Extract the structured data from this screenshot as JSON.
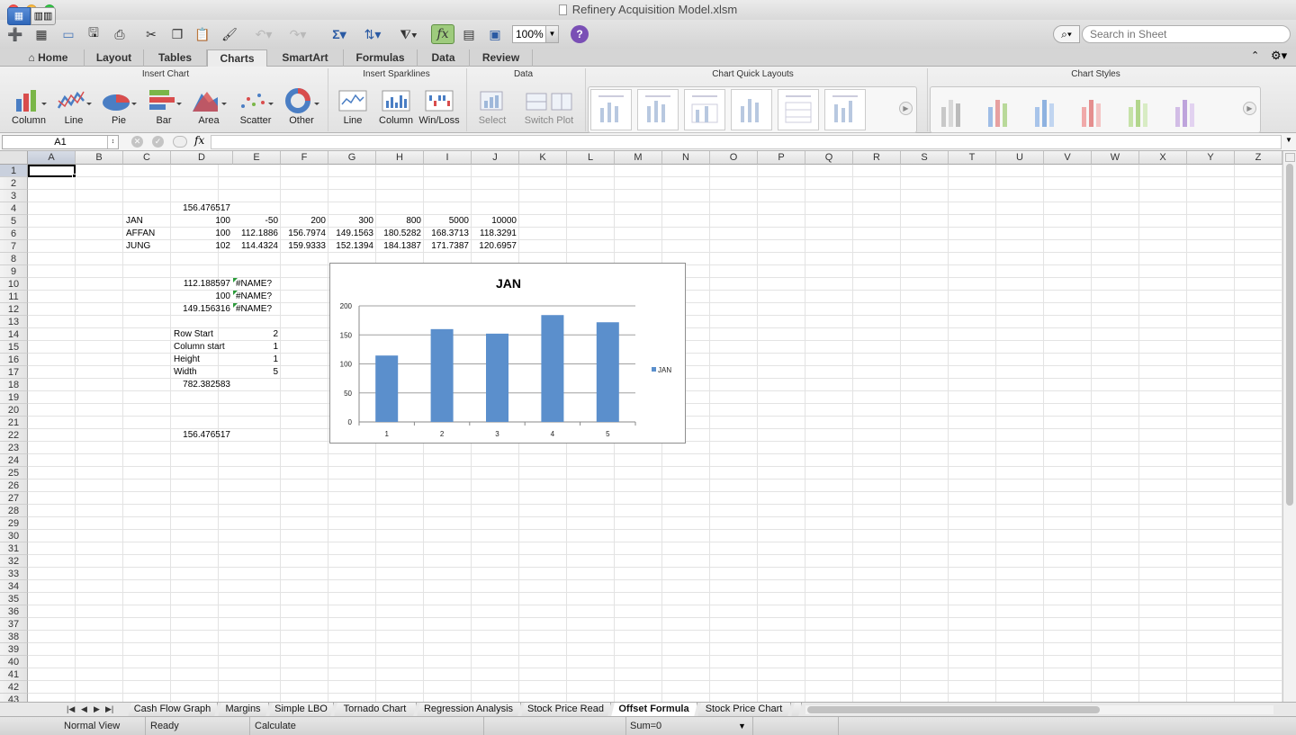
{
  "window": {
    "title": "Refinery Acquisition Model.xlsm"
  },
  "toolbar": {
    "zoom": "100%",
    "search_placeholder": "Search in Sheet"
  },
  "ribbon_tabs": [
    "Home",
    "Layout",
    "Tables",
    "Charts",
    "SmartArt",
    "Formulas",
    "Data",
    "Review"
  ],
  "ribbon_active_tab": "Charts",
  "ribbon": {
    "insert_chart": {
      "title": "Insert Chart",
      "buttons": [
        "Column",
        "Line",
        "Pie",
        "Bar",
        "Area",
        "Scatter",
        "Other"
      ]
    },
    "insert_sparklines": {
      "title": "Insert Sparklines",
      "buttons": [
        "Line",
        "Column",
        "Win/Loss"
      ]
    },
    "data": {
      "title": "Data",
      "buttons": [
        "Select",
        "Switch Plot"
      ]
    },
    "quick_layouts": {
      "title": "Chart Quick Layouts"
    },
    "chart_styles": {
      "title": "Chart Styles"
    }
  },
  "formula_bar": {
    "name_box": "A1",
    "fx_label": "fx",
    "formula": ""
  },
  "columns": [
    "A",
    "B",
    "C",
    "D",
    "E",
    "F",
    "G",
    "H",
    "I",
    "J",
    "K",
    "L",
    "M",
    "N",
    "O",
    "P",
    "Q",
    "R",
    "S",
    "T",
    "U",
    "V",
    "W",
    "X",
    "Y",
    "Z"
  ],
  "rows": [
    "1",
    "2",
    "3",
    "4",
    "5",
    "6",
    "7",
    "8",
    "9",
    "10",
    "11",
    "12",
    "13",
    "14",
    "15",
    "16",
    "17",
    "18",
    "19",
    "20",
    "21",
    "22",
    "23",
    "24",
    "25",
    "26",
    "27",
    "28",
    "29",
    "30",
    "31",
    "32",
    "33",
    "34",
    "35",
    "36",
    "37",
    "38",
    "39",
    "40",
    "41",
    "42",
    "43"
  ],
  "cells": [
    {
      "ref": "D4",
      "value": "156.476517",
      "align": "r"
    },
    {
      "ref": "C5",
      "value": "JAN",
      "align": "l"
    },
    {
      "ref": "D5",
      "value": "100",
      "align": "r"
    },
    {
      "ref": "E5",
      "value": "-50",
      "align": "r"
    },
    {
      "ref": "F5",
      "value": "200",
      "align": "r"
    },
    {
      "ref": "G5",
      "value": "300",
      "align": "r"
    },
    {
      "ref": "H5",
      "value": "800",
      "align": "r"
    },
    {
      "ref": "I5",
      "value": "5000",
      "align": "r"
    },
    {
      "ref": "J5",
      "value": "10000",
      "align": "r"
    },
    {
      "ref": "C6",
      "value": "AFFAN",
      "align": "l"
    },
    {
      "ref": "D6",
      "value": "100",
      "align": "r"
    },
    {
      "ref": "E6",
      "value": "112.1886",
      "align": "r"
    },
    {
      "ref": "F6",
      "value": "156.7974",
      "align": "r"
    },
    {
      "ref": "G6",
      "value": "149.1563",
      "align": "r"
    },
    {
      "ref": "H6",
      "value": "180.5282",
      "align": "r"
    },
    {
      "ref": "I6",
      "value": "168.3713",
      "align": "r"
    },
    {
      "ref": "J6",
      "value": "118.3291",
      "align": "r"
    },
    {
      "ref": "C7",
      "value": "JUNG",
      "align": "l"
    },
    {
      "ref": "D7",
      "value": "102",
      "align": "r"
    },
    {
      "ref": "E7",
      "value": "114.4324",
      "align": "r"
    },
    {
      "ref": "F7",
      "value": "159.9333",
      "align": "r"
    },
    {
      "ref": "G7",
      "value": "152.1394",
      "align": "r"
    },
    {
      "ref": "H7",
      "value": "184.1387",
      "align": "r"
    },
    {
      "ref": "I7",
      "value": "171.7387",
      "align": "r"
    },
    {
      "ref": "J7",
      "value": "120.6957",
      "align": "r"
    },
    {
      "ref": "D10",
      "value": "112.188597",
      "align": "r"
    },
    {
      "ref": "E10",
      "value": "#NAME?",
      "align": "l",
      "error": true
    },
    {
      "ref": "D11",
      "value": "100",
      "align": "r"
    },
    {
      "ref": "E11",
      "value": "#NAME?",
      "align": "l",
      "error": true
    },
    {
      "ref": "D12",
      "value": "149.156316",
      "align": "r"
    },
    {
      "ref": "E12",
      "value": "#NAME?",
      "align": "l",
      "error": true
    },
    {
      "ref": "D14",
      "value": "Row Start",
      "align": "l"
    },
    {
      "ref": "E14",
      "value": "2",
      "align": "r"
    },
    {
      "ref": "D15",
      "value": "Column start",
      "align": "l"
    },
    {
      "ref": "E15",
      "value": "1",
      "align": "r"
    },
    {
      "ref": "D16",
      "value": "Height",
      "align": "l"
    },
    {
      "ref": "E16",
      "value": "1",
      "align": "r"
    },
    {
      "ref": "D17",
      "value": "Width",
      "align": "l"
    },
    {
      "ref": "E17",
      "value": "5",
      "align": "r"
    },
    {
      "ref": "D18",
      "value": "782.382583",
      "align": "r"
    },
    {
      "ref": "D22",
      "value": "156.476517",
      "align": "r"
    }
  ],
  "chart_data": {
    "type": "bar",
    "title": "JAN",
    "categories": [
      "1",
      "2",
      "3",
      "4",
      "5"
    ],
    "series": [
      {
        "name": "JAN",
        "values": [
          114.4324,
          159.9333,
          152.1394,
          184.1387,
          171.7387
        ]
      }
    ],
    "ylim": [
      0,
      200
    ],
    "yticks": [
      0,
      50,
      100,
      150,
      200
    ],
    "grid": true,
    "legend": "right",
    "bar_color": "#5b8fcc"
  },
  "sheet_tabs": [
    "Cash Flow Graph",
    "Margins",
    "Simple LBO",
    "Tornado Chart",
    "Regression Analysis",
    "Stock Price Read",
    "Offset Formula",
    "Stock Price Chart"
  ],
  "active_sheet": "Offset Formula",
  "status": {
    "view": "Normal View",
    "state": "Ready",
    "calc": "Calculate",
    "sum": "Sum=0"
  }
}
